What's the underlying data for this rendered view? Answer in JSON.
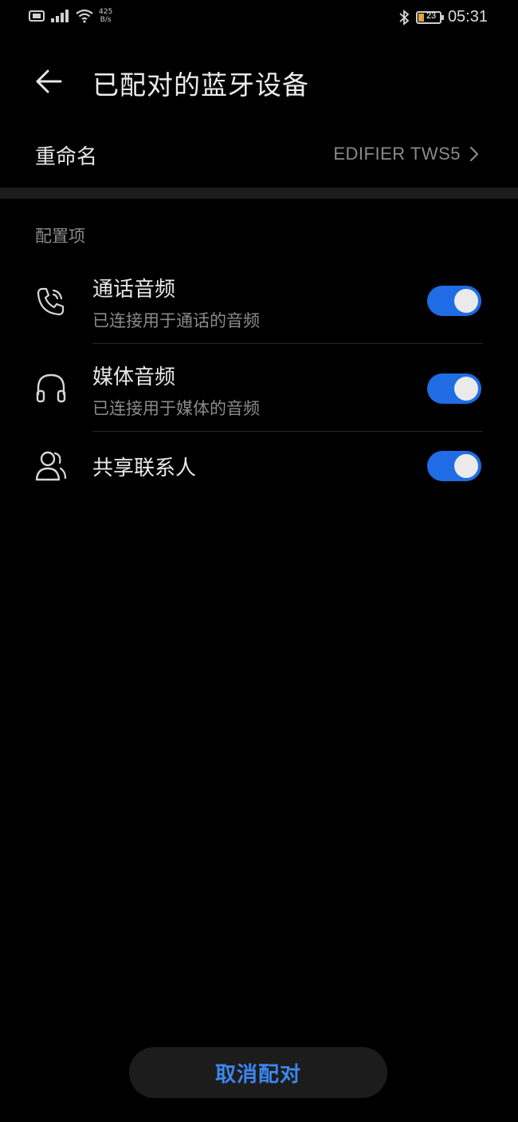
{
  "status_bar": {
    "net_speed_value": "425",
    "net_speed_unit": "B/s",
    "battery_level": "23",
    "battery_fraction": 0.23,
    "time": "05:31",
    "icons": [
      "sim-card-icon",
      "signal-icon",
      "wifi-icon",
      "bluetooth-icon",
      "battery-icon"
    ]
  },
  "header": {
    "title": "已配对的蓝牙设备"
  },
  "rename": {
    "label": "重命名",
    "value": "EDIFIER TWS5"
  },
  "section": {
    "label": "配置项"
  },
  "settings": [
    {
      "title": "通话音频",
      "subtitle": "已连接用于通话的音频",
      "icon": "phone-icon",
      "enabled": true
    },
    {
      "title": "媒体音频",
      "subtitle": "已连接用于媒体的音频",
      "icon": "headphones-icon",
      "enabled": true
    },
    {
      "title": "共享联系人",
      "subtitle": "",
      "icon": "contacts-icon",
      "enabled": true
    }
  ],
  "footer": {
    "unpair_label": "取消配对"
  },
  "colors": {
    "background": "#000000",
    "toggle_on": "#1f6ce5",
    "accent_text": "#3c86ee",
    "secondary_text": "#8a8a8a"
  }
}
